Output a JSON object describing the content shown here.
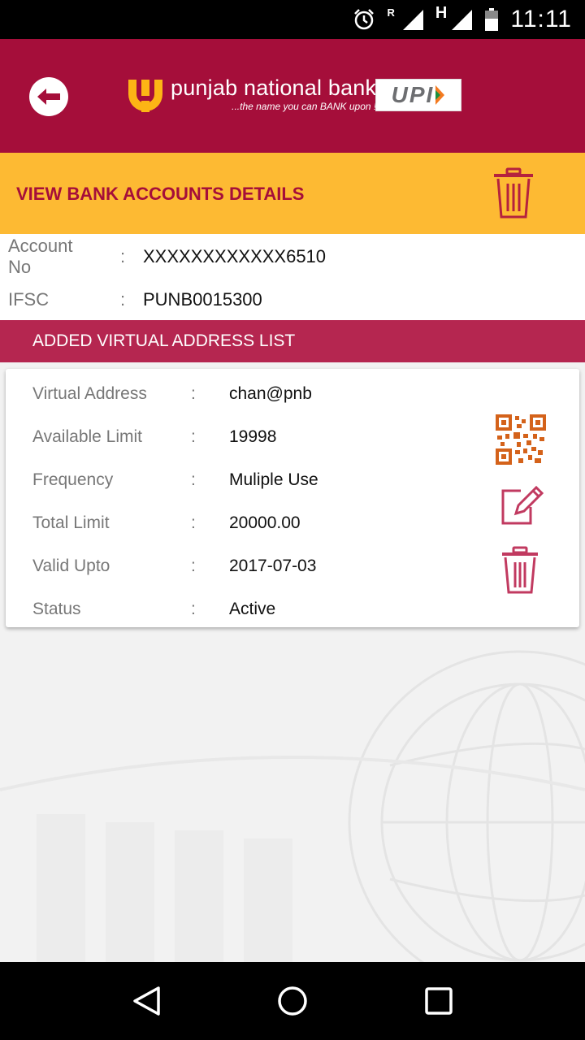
{
  "status_bar": {
    "time": "11:11",
    "roaming_label": "R",
    "network_label": "H",
    "icons": [
      "alarm-icon",
      "signal-roaming-icon",
      "signal-h-icon",
      "battery-icon"
    ]
  },
  "header": {
    "brand_name": "punjab national bank",
    "tagline": "...the name you can BANK upon !",
    "upi_label": "UPI",
    "colors": {
      "primary": "#a50e3a",
      "logo_gold": "#fdb515"
    }
  },
  "title_bar": {
    "title": "VIEW BANK ACCOUNTS DETAILS",
    "color": "#fdba33"
  },
  "account": {
    "rows": [
      {
        "label": "Account No",
        "colon": ":",
        "value": "XXXXXXXXXXXX6510"
      },
      {
        "label": "IFSC",
        "colon": ":",
        "value": "PUNB0015300"
      }
    ]
  },
  "virtual_address_list": {
    "header": "ADDED VIRTUAL ADDRESS LIST",
    "items": [
      {
        "fields": [
          {
            "label": "Virtual Address",
            "colon": ":",
            "value": "chan@pnb"
          },
          {
            "label": "Available Limit",
            "colon": ":",
            "value": "19998"
          },
          {
            "label": "Frequency",
            "colon": ":",
            "value": "Muliple Use"
          },
          {
            "label": "Total Limit",
            "colon": ":",
            "value": "20000.00"
          },
          {
            "label": "Valid Upto",
            "colon": ":",
            "value": "2017-07-03"
          },
          {
            "label": "Status",
            "colon": ":",
            "value": "Active"
          }
        ],
        "actions": [
          "qr-code-icon",
          "edit-icon",
          "trash-icon"
        ]
      }
    ]
  },
  "nav_bar": {
    "buttons": [
      "back-triangle-icon",
      "home-circle-icon",
      "recents-square-icon"
    ]
  }
}
